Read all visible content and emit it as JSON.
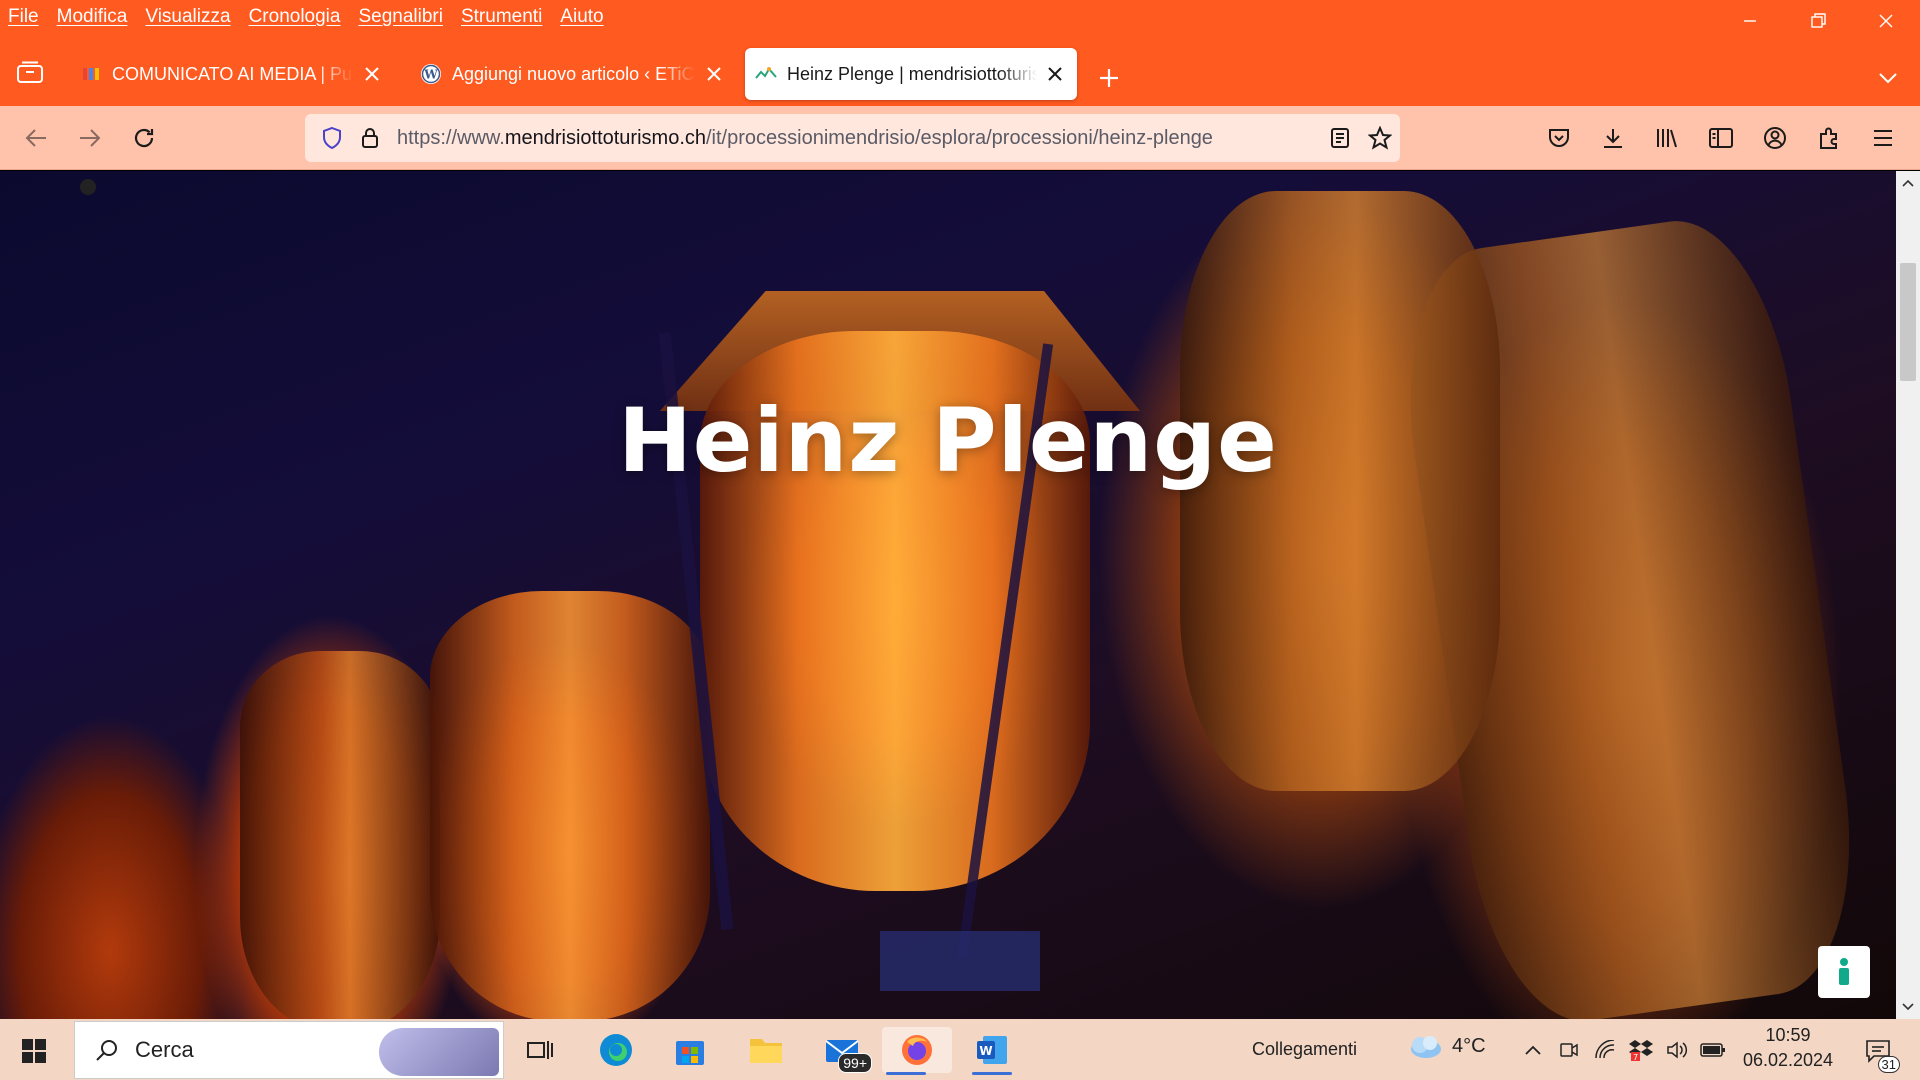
{
  "menubar": {
    "items": [
      "File",
      "Modifica",
      "Visualizza",
      "Cronologia",
      "Segnalibri",
      "Strumenti",
      "Aiuto"
    ]
  },
  "window_controls": {
    "minimize": "minimize-icon",
    "restore": "restore-icon",
    "close": "close-icon"
  },
  "tabs": [
    {
      "title": "COMUNICATO AI MEDIA | Pubblico",
      "favicon": "google-colored-icon",
      "active": false
    },
    {
      "title": "Aggiungi nuovo articolo ‹ ETiCinema",
      "favicon": "wordpress-icon",
      "active": false
    },
    {
      "title": "Heinz Plenge | mendrisiottoturismo",
      "favicon": "site-icon",
      "active": true
    }
  ],
  "navbar": {
    "url_prefix": "https://www.",
    "url_domain": "mendrisiottoturismo.ch",
    "url_path": "/it/processionimendrisio/esplora/processioni/heinz-plenge"
  },
  "page": {
    "hero_title": "Heinz Plenge"
  },
  "taskbar": {
    "search_label": "Cerca",
    "mail_badge": "99+",
    "collegamenti": "Collegamenti",
    "temperature": "4°C",
    "time": "10:59",
    "date": "06.02.2024",
    "notifications": "31"
  },
  "colors": {
    "accent": "#ff5a1f",
    "navbar": "#ffc2ab",
    "taskbar": "#f3d6c4"
  }
}
